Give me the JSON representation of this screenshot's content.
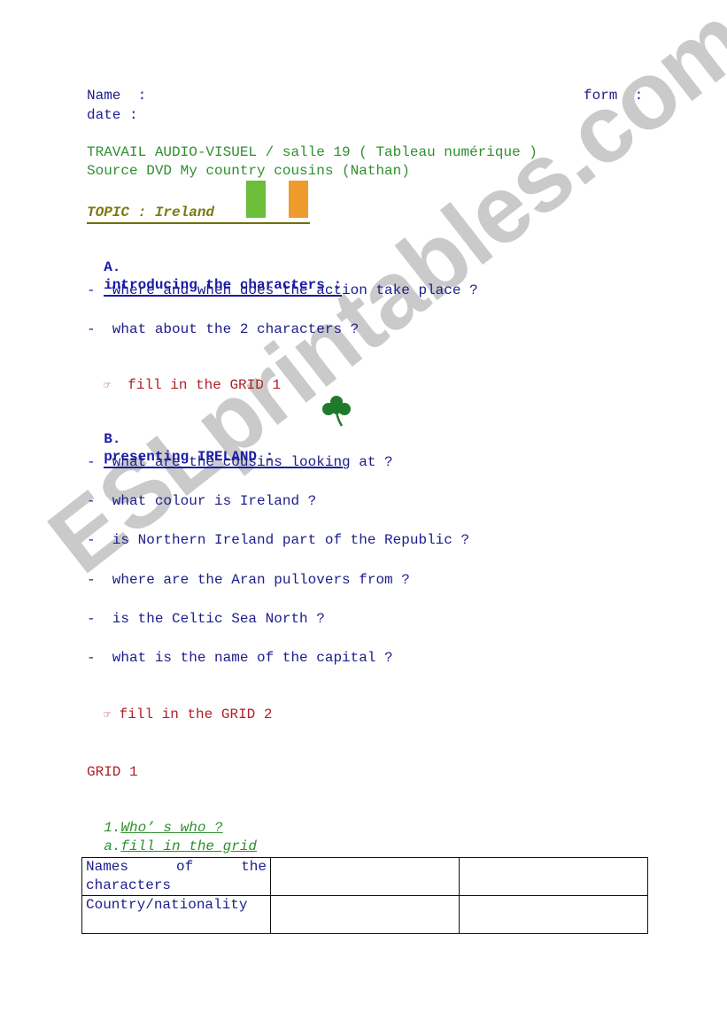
{
  "header": {
    "name_label": "Name  :",
    "form_label": "form  :",
    "date_label": "date :"
  },
  "intro": {
    "line1": "TRAVAIL AUDIO-VISUEL / salle 19 ( Tableau numérique )",
    "line2": "Source DVD My country cousins (Nathan)",
    "topic": "TOPIC : Ireland",
    "flag_colors": [
      "#6bbd3a",
      "#ffffff",
      "#ee9a2c"
    ]
  },
  "section_a": {
    "letter": "A.",
    "title": "introducing the characters :",
    "questions": [
      "-  where and when does the action take place ?",
      "-  what about the 2 characters ?"
    ],
    "instruction_icon": "pointing-hand-icon",
    "instruction": "fill in the GRID 1"
  },
  "section_b": {
    "letter": "B.",
    "title": "presenting IRELAND : ",
    "icon": "shamrock-icon",
    "questions": [
      "-  what are the cousins looking at ?",
      "-  what colour is Ireland ?",
      "-  is Northern Ireland part of the Republic ?",
      "-  where are the Aran pullovers from ?",
      "-  is the Celtic Sea North ?",
      "-  what is the name of the capital ?"
    ],
    "instruction_icon": "pointing-hand-icon",
    "instruction": "fill in the GRID 2"
  },
  "grid1": {
    "title": "GRID 1",
    "sub1_num": "1.",
    "sub1": "Who’ s who ?",
    "sub2_num": "a.",
    "sub2": "fill in the grid",
    "rows": [
      {
        "label": "Names of the characters",
        "cells": [
          "",
          ""
        ]
      },
      {
        "label": "Country/nationality",
        "cells": [
          "",
          ""
        ]
      }
    ]
  },
  "watermark": "ESLprintables.com",
  "colors": {
    "text_navy": "#1c1c8c",
    "heading_blue": "#1a1aa8",
    "instruction_red": "#b0202a",
    "subtitle_green": "#2f8f2f",
    "topic_olive": "#7a7a10"
  }
}
